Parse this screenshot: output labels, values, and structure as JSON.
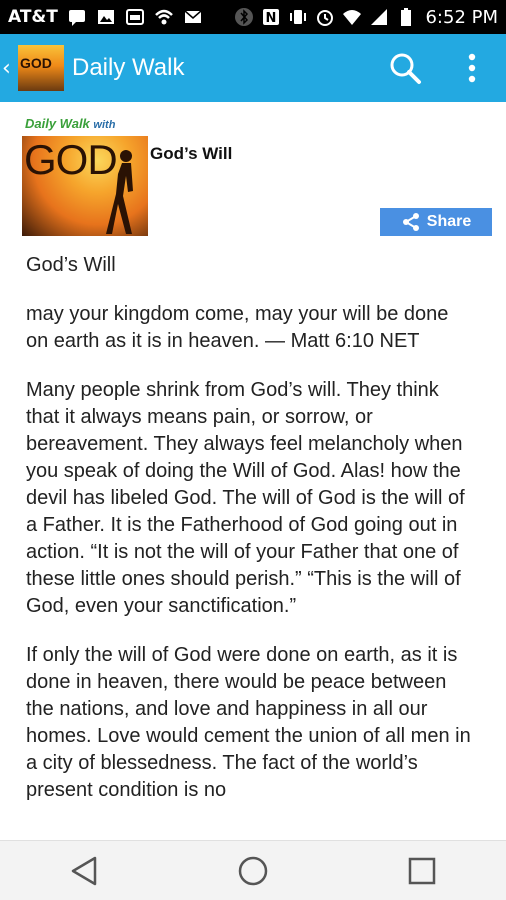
{
  "status_bar": {
    "carrier": "AT&T",
    "time": "6:52 PM",
    "icons_left": [
      "message-icon",
      "image-icon",
      "car-icon",
      "wifi-hotspot-icon",
      "mail-icon"
    ],
    "icons_right": [
      "bluetooth-icon",
      "nfc-icon",
      "vibrate-icon",
      "alarm-icon",
      "wifi-icon",
      "signal-icon",
      "battery-icon"
    ]
  },
  "app_bar": {
    "title": "Daily Walk",
    "logo_text": "GOD",
    "actions": [
      "search-icon",
      "overflow-menu-icon"
    ]
  },
  "post": {
    "cover_brand": "Daily Walk",
    "cover_brand_with": "with",
    "cover_word": "GOD",
    "title": "God’s Will",
    "share_label": "Share"
  },
  "article": {
    "heading": "God’s Will",
    "paragraphs": [
      "may your kingdom come, may your will be done on earth as it is in heaven. — Matt 6:10 NET",
      "Many people shrink from God’s will. They think that it always means pain, or sorrow, or bereavement. They always feel melancholy when you speak of doing the Will of God. Alas! how the devil has libeled God. The will of God is the will of a Father. It is the Fatherhood of God going out in action. “It is not the will of your Father that one of these little ones should perish.” “This is the will of God, even your sanctification.”",
      "If only the will of God were done on earth, as it is done in heaven, there would be peace between the nations, and love and happiness in all our homes. Love would cement the union of all men in a city of blessedness. The fact of the world’s present condition is no"
    ]
  },
  "nav_bar": {
    "buttons": [
      "back-icon",
      "home-icon",
      "recents-icon"
    ]
  },
  "colors": {
    "app_bar": "#23a9e1",
    "share_button": "#4a90e2",
    "status_bar": "#000000"
  }
}
